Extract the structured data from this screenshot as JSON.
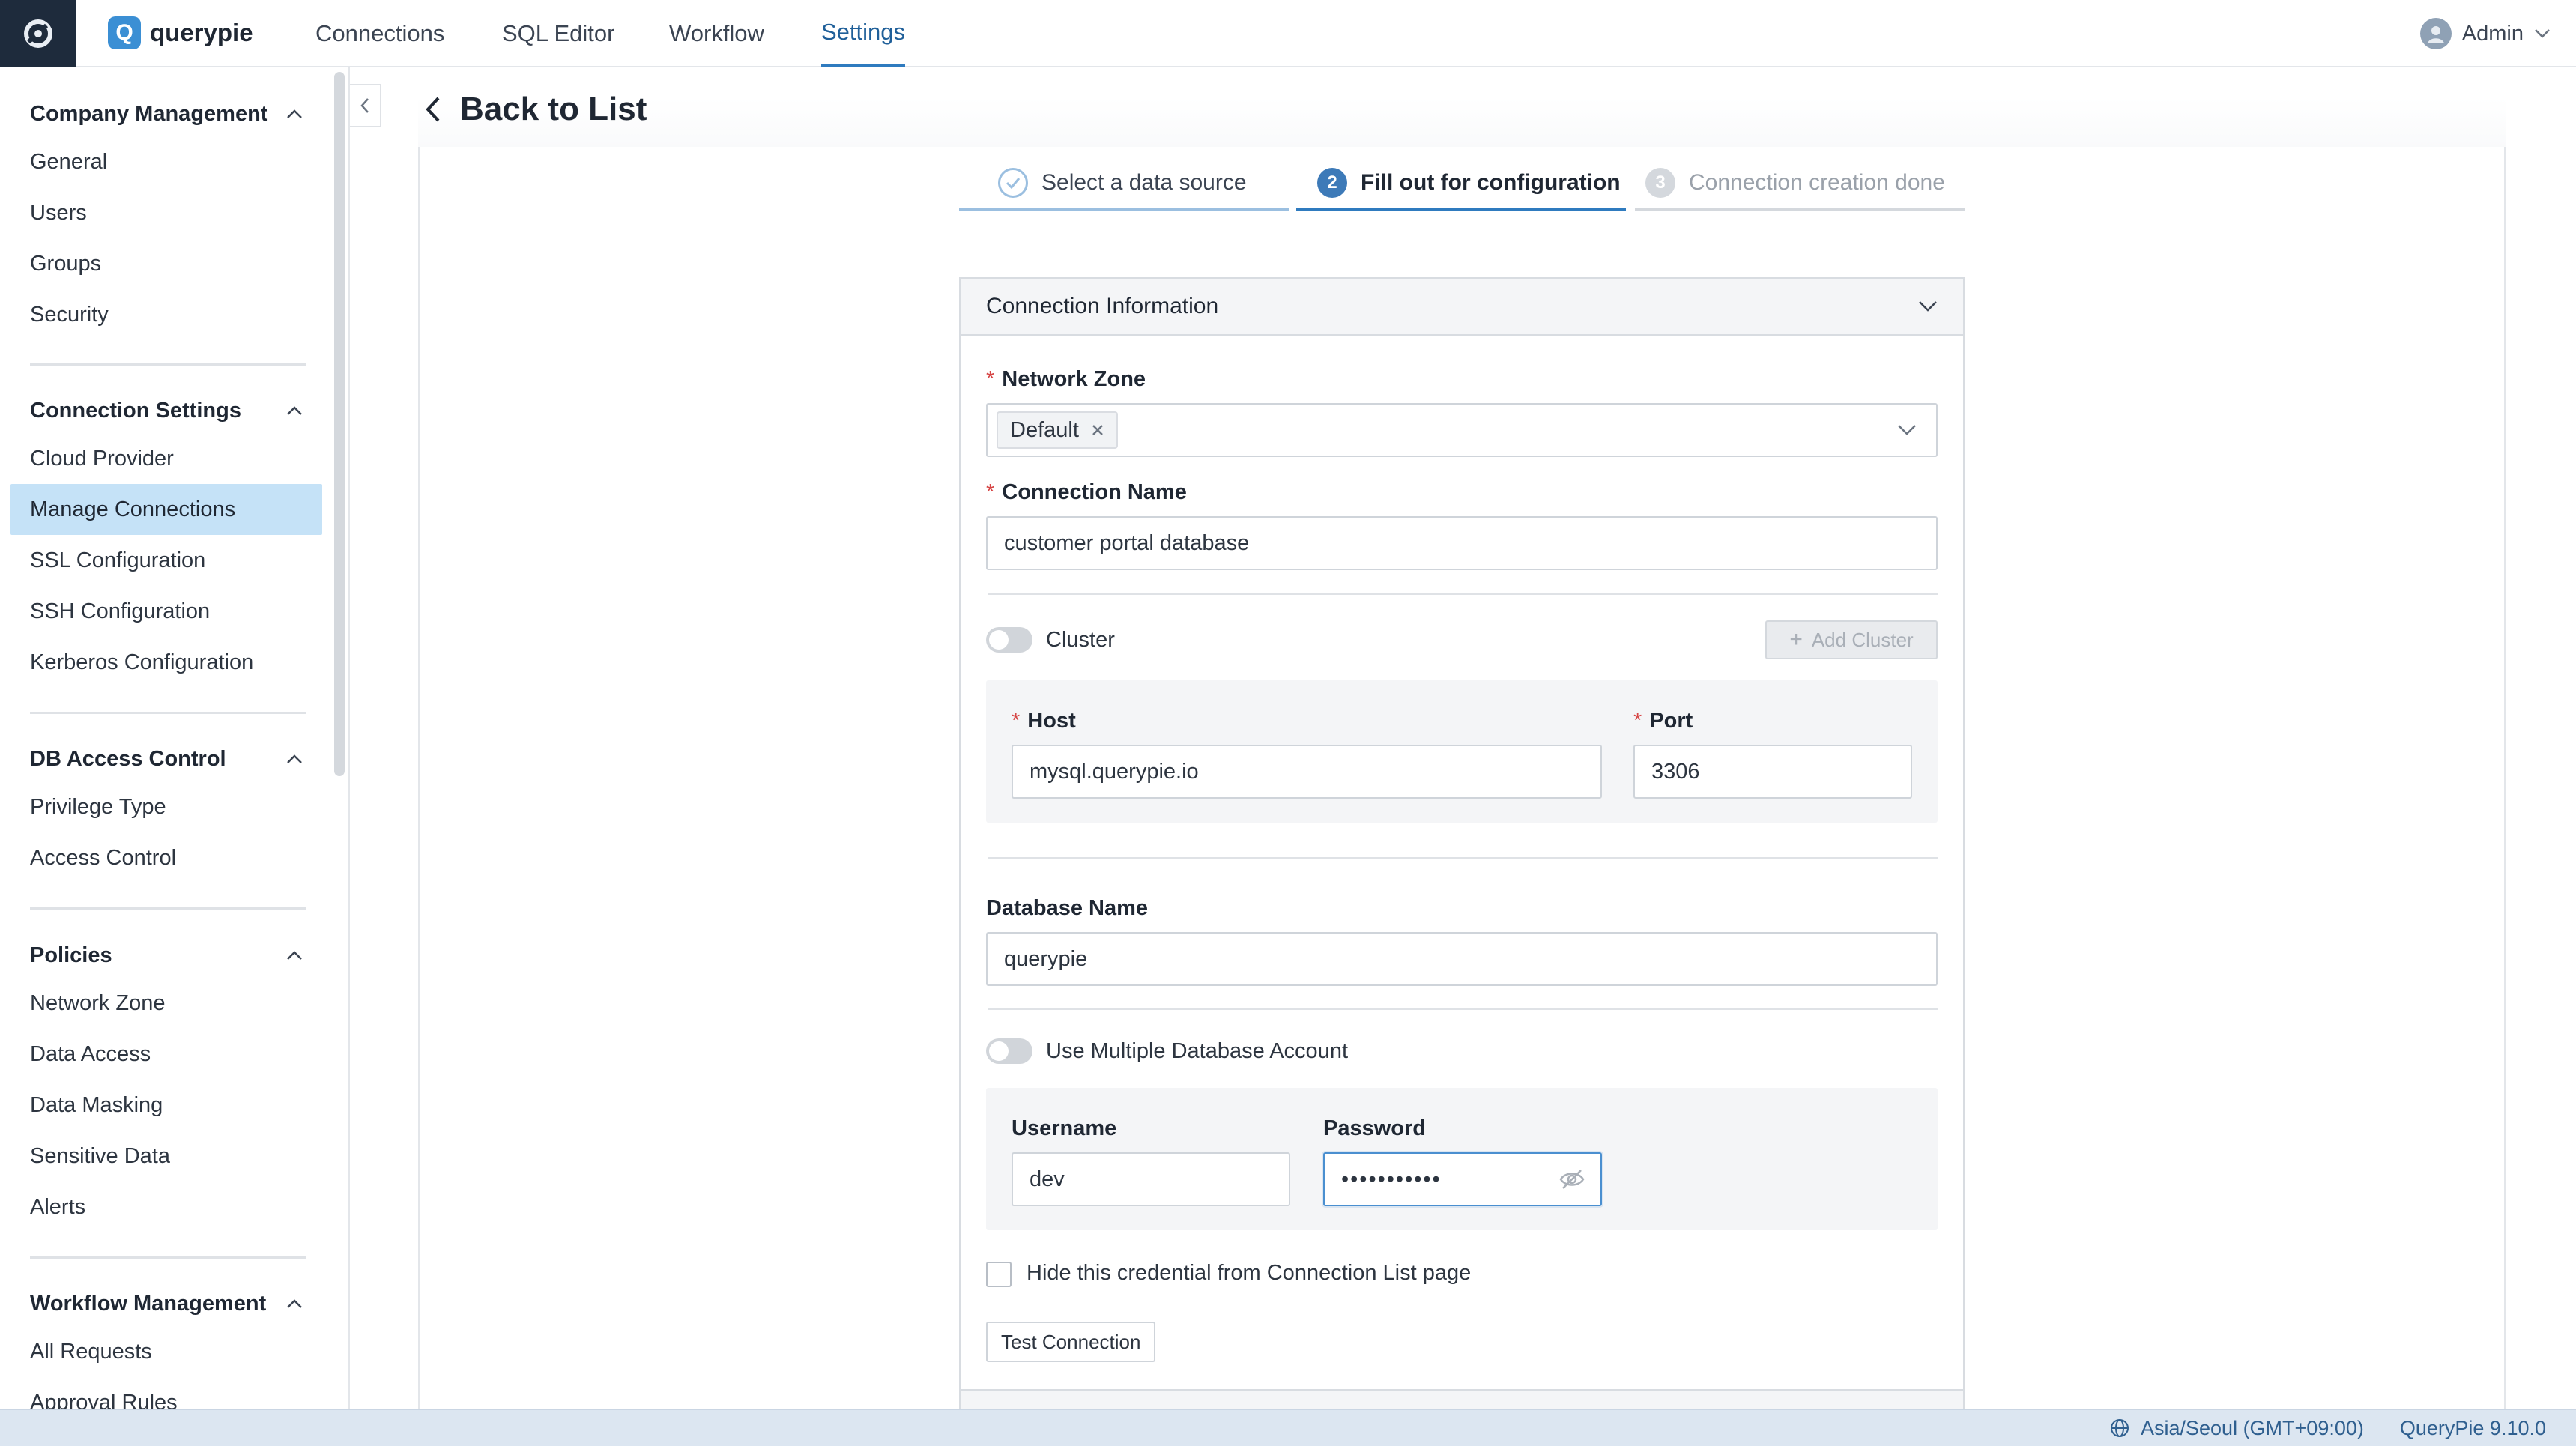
{
  "app": {
    "brand_name": "querypie",
    "brand_letter": "Q"
  },
  "nav": {
    "tabs": [
      {
        "label": "Connections"
      },
      {
        "label": "SQL Editor"
      },
      {
        "label": "Workflow"
      },
      {
        "label": "Settings",
        "active": true
      }
    ],
    "user": "Admin"
  },
  "sidebar": {
    "groups": [
      {
        "title": "Company Management",
        "items": [
          "General",
          "Users",
          "Groups",
          "Security"
        ]
      },
      {
        "title": "Connection Settings",
        "items": [
          "Cloud Provider",
          "Manage Connections",
          "SSL Configuration",
          "SSH Configuration",
          "Kerberos Configuration"
        ],
        "active_item": "Manage Connections"
      },
      {
        "title": "DB Access Control",
        "items": [
          "Privilege Type",
          "Access Control"
        ]
      },
      {
        "title": "Policies",
        "items": [
          "Network Zone",
          "Data Access",
          "Data Masking",
          "Sensitive Data",
          "Alerts"
        ]
      },
      {
        "title": "Workflow Management",
        "items": [
          "All Requests",
          "Approval Rules"
        ]
      }
    ]
  },
  "page": {
    "back_label": "Back to List"
  },
  "stepper": {
    "steps": [
      {
        "number": "1",
        "label": "Select a data source",
        "state": "done"
      },
      {
        "number": "2",
        "label": "Fill out for configuration",
        "state": "current"
      },
      {
        "number": "3",
        "label": "Connection creation done",
        "state": "todo"
      }
    ]
  },
  "form": {
    "section_title": "Connection Information",
    "network_zone": {
      "label": "Network Zone",
      "required_mark": "*",
      "tag": "Default"
    },
    "connection_name": {
      "label": "Connection Name",
      "required_mark": "*",
      "value": "customer portal database"
    },
    "cluster": {
      "label": "Cluster",
      "enabled": false,
      "add_button": "Add Cluster"
    },
    "host": {
      "label": "Host",
      "required_mark": "*",
      "value": "mysql.querypie.io"
    },
    "port": {
      "label": "Port",
      "required_mark": "*",
      "value": "3306"
    },
    "database_name": {
      "label": "Database Name",
      "value": "querypie"
    },
    "multi_account": {
      "label": "Use Multiple Database Account",
      "enabled": false
    },
    "username": {
      "label": "Username",
      "value": "dev"
    },
    "password": {
      "label": "Password",
      "masked_value": "•••••••••••"
    },
    "hide_credential": {
      "label": "Hide this credential from Connection List page",
      "checked": false
    },
    "test_button": "Test Connection"
  },
  "status": {
    "timezone": "Asia/Seoul (GMT+09:00)",
    "version": "QueryPie 9.10.0"
  },
  "colors": {
    "accent": "#2f7bbf",
    "active_sidebar_bg": "#c5e2f7",
    "status_bar_bg": "#dce6f1",
    "required": "#d64545"
  }
}
